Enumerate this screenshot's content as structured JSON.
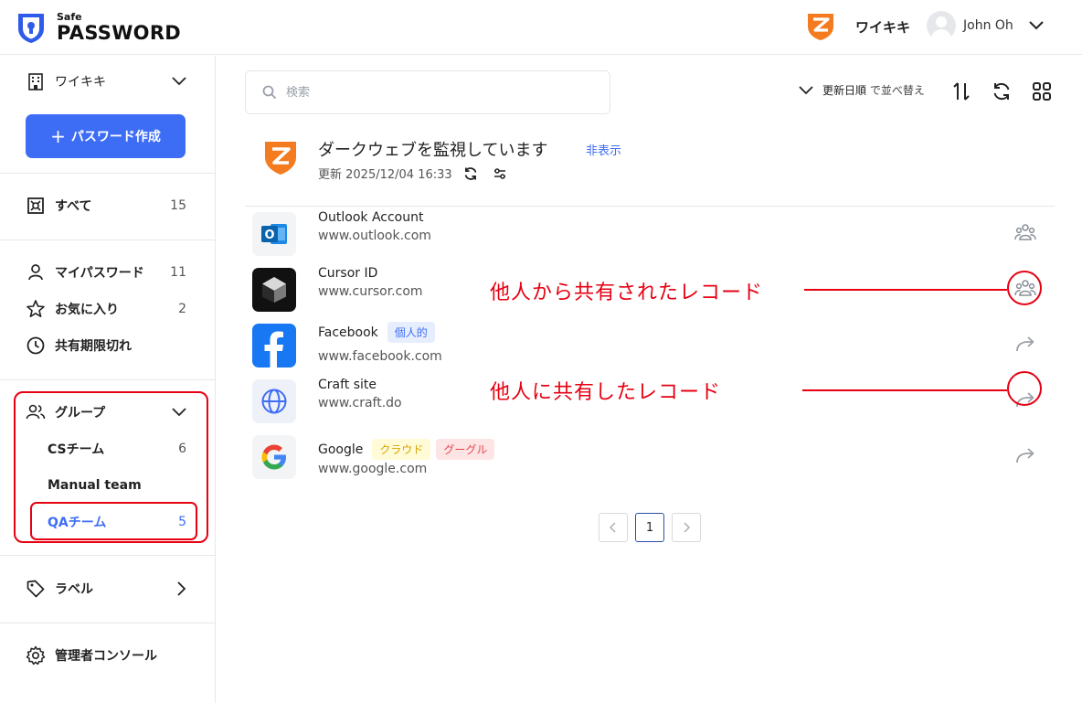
{
  "header": {
    "brand_small": "Safe",
    "brand_big": "PASSWORD",
    "org_name": "ワイキキ",
    "user_name": "John Oh"
  },
  "sidebar": {
    "workspace": "ワイキキ",
    "create_button": "パスワード作成",
    "all": {
      "label": "すべて",
      "count": "15"
    },
    "items": [
      {
        "label": "マイパスワード",
        "count": "11"
      },
      {
        "label": "お気に入り",
        "count": "2"
      },
      {
        "label": "共有期限切れ",
        "count": ""
      }
    ],
    "groups": {
      "label": "グループ",
      "items": [
        {
          "label": "CSチーム",
          "count": "6"
        },
        {
          "label": "Manual team",
          "count": ""
        },
        {
          "label": "QAチーム",
          "count": "5"
        }
      ]
    },
    "labels": "ラベル",
    "admin": "管理者コンソール"
  },
  "toolbar": {
    "search_placeholder": "検索",
    "sort_field": "更新日順",
    "sort_suffix": "で並べ替え"
  },
  "dark_web": {
    "title": "ダークウェブを監視しています",
    "hide": "非表示",
    "updated": "更新 2025/12/04 16:33"
  },
  "records": [
    {
      "name": "Outlook Account",
      "url": "www.outlook.com",
      "tags": [],
      "share": "shared-with-me"
    },
    {
      "name": "Cursor ID",
      "url": "www.cursor.com",
      "tags": [],
      "share": "shared-with-me"
    },
    {
      "name": "Facebook",
      "url": "www.facebook.com",
      "tags": [
        "個人的"
      ],
      "share": "shared-by-me"
    },
    {
      "name": "Craft site",
      "url": "www.craft.do",
      "tags": [],
      "share": "shared-by-me"
    },
    {
      "name": "Google",
      "url": "www.google.com",
      "tags": [
        "クラウド",
        "グーグル"
      ],
      "share": "shared-by-me"
    }
  ],
  "annotations": {
    "shared_with_me": "他人から共有されたレコード",
    "shared_by_me": "他人に共有したレコード"
  },
  "pagination": {
    "current": "1"
  },
  "colors": {
    "accent": "#3e6df5",
    "annotation": "#e60012",
    "brand_orange": "#f47b20",
    "tag_personal_bg": "#e6edfd",
    "tag_cloud_bg": "#fffbd6",
    "tag_google_bg": "#fde5e5"
  }
}
